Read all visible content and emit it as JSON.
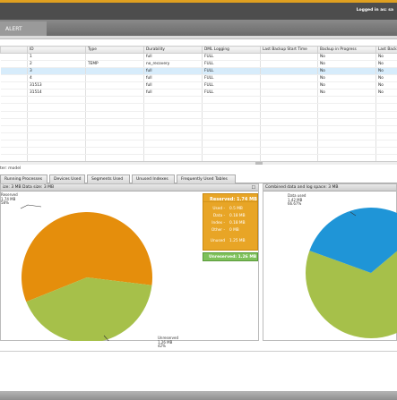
{
  "header": {
    "logged_in": "Logged in as: sa",
    "tab": "ALERT"
  },
  "table": {
    "columns": [
      "",
      "ID",
      "Type",
      "Durability",
      "DML Logging",
      "Last Backup Start Time",
      "Backup in Progress",
      "Last Backup"
    ],
    "rows": [
      [
        "",
        "1",
        "",
        "full",
        "FULL",
        "",
        "No",
        "No"
      ],
      [
        "",
        "2",
        "TEMP",
        "no_recovery",
        "FULL",
        "",
        "No",
        "No"
      ],
      [
        "",
        "3",
        "",
        "full",
        "FULL",
        "",
        "No",
        "No"
      ],
      [
        "",
        "4",
        "",
        "full",
        "FULL",
        "",
        "No",
        "No"
      ],
      [
        "",
        "31513",
        "",
        "full",
        "FULL",
        "",
        "No",
        "No"
      ],
      [
        "",
        "31514",
        "",
        "full",
        "FULL",
        "",
        "No",
        "No"
      ],
      [
        "",
        "",
        "",
        "",
        "",
        "",
        "",
        ""
      ],
      [
        "",
        "",
        "",
        "",
        "",
        "",
        "",
        ""
      ],
      [
        "",
        "",
        "",
        "",
        "",
        "",
        "",
        ""
      ],
      [
        "",
        "",
        "",
        "",
        "",
        "",
        "",
        ""
      ],
      [
        "",
        "",
        "",
        "",
        "",
        "",
        "",
        ""
      ],
      [
        "",
        "",
        "",
        "",
        "",
        "",
        "",
        ""
      ],
      [
        "",
        "",
        "",
        "",
        "",
        "",
        "",
        ""
      ],
      [
        "",
        "",
        "",
        "",
        "",
        "",
        "",
        ""
      ],
      [
        "",
        "",
        "",
        "",
        "",
        "",
        "",
        ""
      ]
    ],
    "selected_row": 2
  },
  "model_label": "ter: model",
  "bottom_tabs": [
    "Running Processes",
    "Devices Used",
    "Segments Used",
    "Unused Indexes",
    "Frequently Used Tables"
  ],
  "left_panel": {
    "title": "ize: 3 MB    Data size: 3 MB",
    "reserved": {
      "title": "Reserved: 1.74 MB",
      "rows": [
        {
          "k": "Used -",
          "v": "0.5 MB"
        },
        {
          "k": "Data -",
          "v": "0.18 MB"
        },
        {
          "k": "Index -",
          "v": "0.18 MB"
        },
        {
          "k": "Other -",
          "v": "0 MB"
        },
        {
          "k": "Unused",
          "v": "1.25 MB"
        }
      ]
    },
    "unreserved": "Unreserved: 1.26 MB",
    "callout_top": [
      "Reserved",
      "1.74 MB",
      "58%"
    ],
    "callout_bottom": [
      "Unreserved",
      "1.26 MB",
      "42%"
    ]
  },
  "right_panel": {
    "title": "Combined data and log space: 3 MB",
    "callout": [
      "Data used",
      "1.42 MB",
      "66.67%"
    ]
  },
  "colors": {
    "orange": "#e58e0c",
    "green": "#a6c04a",
    "blue": "#1f95d7"
  },
  "chart_data": [
    {
      "type": "pie",
      "series": [
        {
          "name": "Reserved",
          "value": 1.74
        },
        {
          "name": "Unreserved",
          "value": 1.26
        }
      ]
    },
    {
      "type": "pie",
      "series": [
        {
          "name": "Data used",
          "value": 66.67
        },
        {
          "name": "",
          "value": 33.33
        }
      ]
    }
  ]
}
